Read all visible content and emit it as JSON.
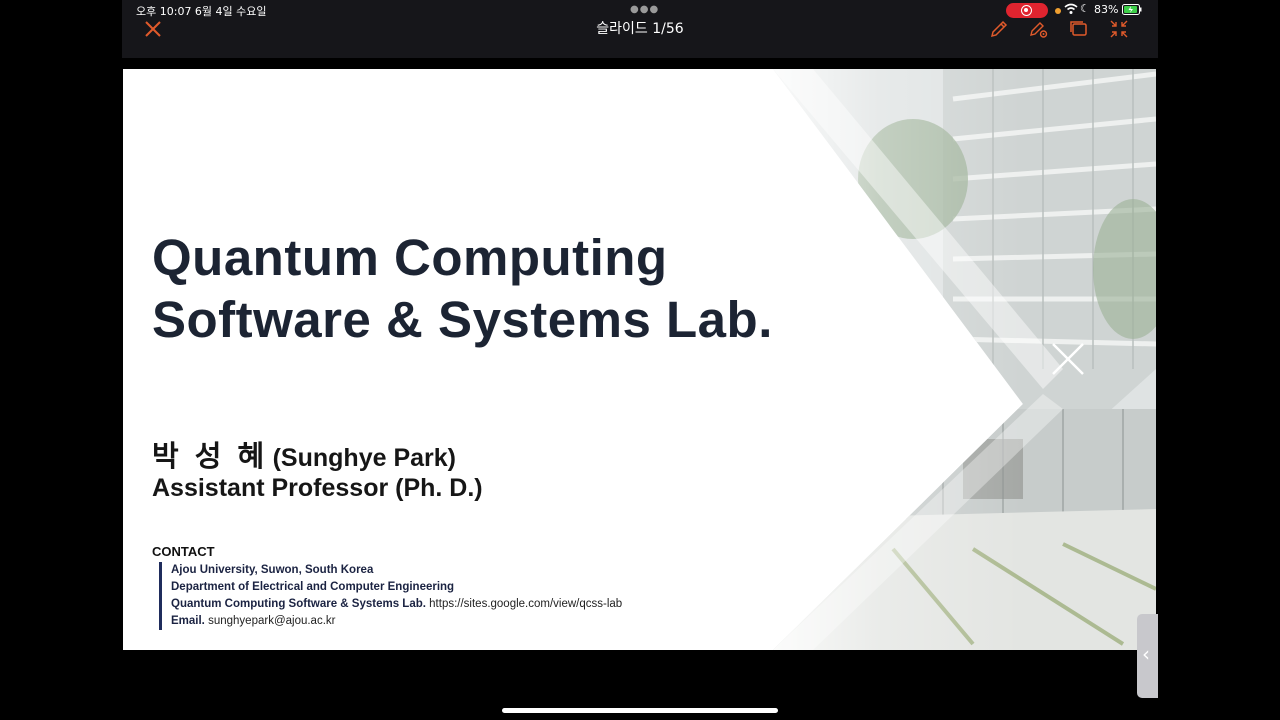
{
  "status_bar": {
    "time_date": "오후 10:07   6월 4일 수요일",
    "battery": "83%"
  },
  "toolbar": {
    "slide_counter": "슬라이드 1/56"
  },
  "slide": {
    "title_line1": "Quantum Computing",
    "title_line2": "Software & Systems Lab.",
    "name_korean": "박 성 혜",
    "name_english": "(Sunghye Park)",
    "position": "Assistant Professor (Ph. D.)",
    "contact_heading": "CONTACT",
    "contact_university": "Ajou University, Suwon, South Korea",
    "contact_department": "Department of Electrical and Computer Engineering",
    "contact_lab_name": "Quantum Computing Software & Systems Lab.",
    "contact_lab_url": "https://sites.google.com/view/qcss-lab",
    "contact_email_label": "Email.",
    "contact_email": "sunghyepark@ajou.ac.kr"
  },
  "icons": [
    "close-icon",
    "pen-icon",
    "settings-icon",
    "window-icon",
    "collapse-icon",
    "wifi-icon",
    "moon-icon",
    "battery-icon",
    "chevron-left-icon"
  ],
  "colors": {
    "accent": "#e05a2b",
    "title": "#1c2433",
    "contact_bar": "#1f2c5c",
    "record": "#e0242f"
  }
}
